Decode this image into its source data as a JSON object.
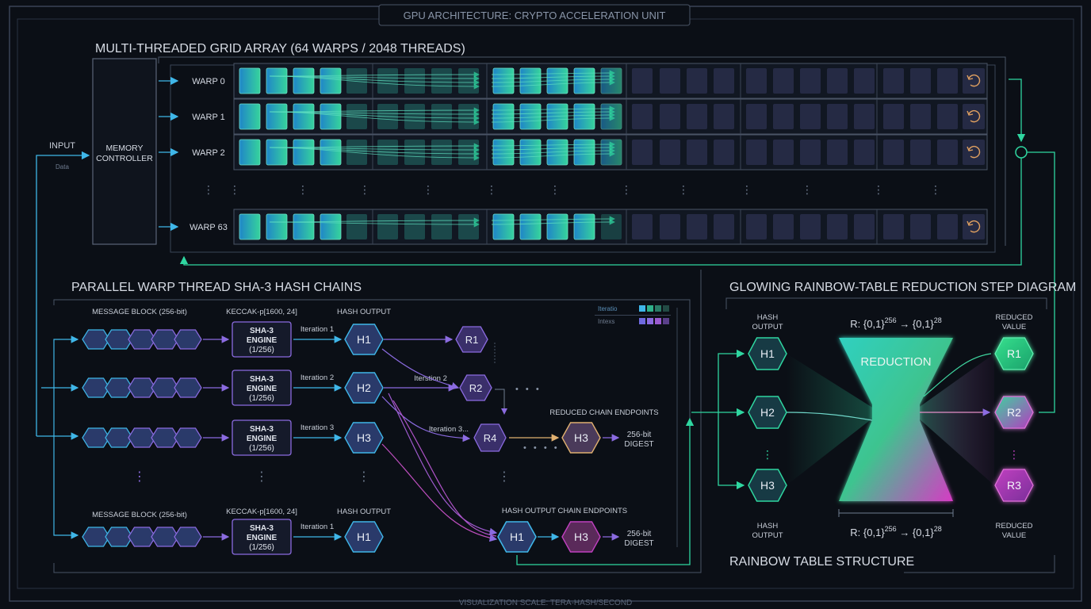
{
  "header": {
    "title": "GPU ARCHITECTURE: CRYPTO ACCELERATION UNIT"
  },
  "footer": {
    "scale": "VISUALIZATION SCALE: TERA-HASH/SECOND"
  },
  "grid": {
    "title": "MULTI-THREADED GRID ARRAY (64 WARPS / 2048 THREADS)",
    "input_label": "INPUT",
    "data_label": "Data",
    "memory_controller": [
      "MEMORY",
      "CONTROLLER"
    ],
    "warps": [
      "WARP 0",
      "WARP 1",
      "WARP 2",
      "WARP 63"
    ]
  },
  "hash_chains": {
    "title": "PARALLEL WARP THREAD SHA-3 HASH CHAINS",
    "message_block_label": "MESSAGE BLOCK (256-bit)",
    "keccak_label": "KECCAK-p[1600, 24]",
    "hash_output_label": "HASH OUTPUT",
    "engine_lines": [
      "SHA-3",
      "ENGINE",
      "(1/256)"
    ],
    "legend": [
      "Iteratio",
      "Intexs"
    ],
    "rows": [
      {
        "iter": "Iteration 1",
        "hash": "H1",
        "reduce": "R1"
      },
      {
        "iter": "Iteration 2",
        "hash": "H2",
        "reduce": "R2",
        "iter_b": "Iterstion 2"
      },
      {
        "iter": "Iteration 3",
        "hash": "H3",
        "iter_b": "Iteration 3...",
        "reduce": "R4",
        "end_hash": "H3",
        "digest": [
          "256-bit",
          "DIGEST"
        ]
      },
      {
        "iter": "Iteration 1",
        "hash": "H1",
        "end_a": "H1",
        "end_b": "H3",
        "digest": [
          "256-bit",
          "DIGEST"
        ]
      }
    ],
    "reduced_endpoints_label": "REDUCED CHAIN ENDPOINTS",
    "hash_output_endpoints_label": "HASH OUTPUT  CHAIN ENDPOINTS"
  },
  "rainbow": {
    "title": "GLOWING RAINBOW-TABLE REDUCTION STEP DIAGRAM",
    "footer": "RAINBOW TABLE STRUCTURE",
    "hash_output": [
      "HASH",
      "OUTPUT"
    ],
    "reduced_value": [
      "REDUCED",
      "VALUE"
    ],
    "formula_base": "R: {0,1}",
    "formula_exp1": "256",
    "formula_arrow": " → {0,1}",
    "formula_exp2": "28",
    "reduction": "REDUCTION",
    "inputs": [
      "H1",
      "H2",
      "H3"
    ],
    "outputs": [
      "R1",
      "R2",
      "R3"
    ]
  },
  "colors": {
    "cyan": "#3fb6e8",
    "teal": "#2fd6a0",
    "green": "#4ce39a",
    "purple": "#8b6be0",
    "magenta": "#d43fbf",
    "frame": "#5a6578"
  }
}
